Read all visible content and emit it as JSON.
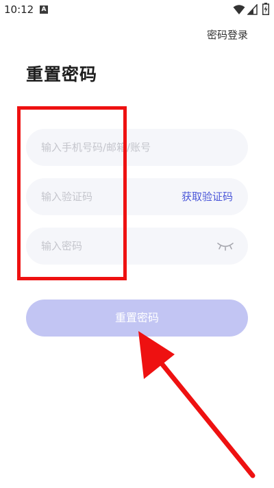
{
  "status_bar": {
    "time": "10:12",
    "notification_letter": "A"
  },
  "header": {
    "link_label": "密码登录"
  },
  "page": {
    "title": "重置密码"
  },
  "form": {
    "account_placeholder": "输入手机号码/邮箱/账号",
    "code_placeholder": "输入验证码",
    "get_code_label": "获取验证码",
    "password_placeholder": "输入密码",
    "submit_label": "重置密码"
  },
  "colors": {
    "accent": "#4a56d8",
    "button_disabled": "#c2c5f3",
    "field_background": "#f5f6fa",
    "annotation_red": "#ee1111"
  },
  "icons": {
    "status": [
      "wifi-icon",
      "signal-icon",
      "battery-icon"
    ],
    "password_toggle": "eye-closed-icon"
  }
}
